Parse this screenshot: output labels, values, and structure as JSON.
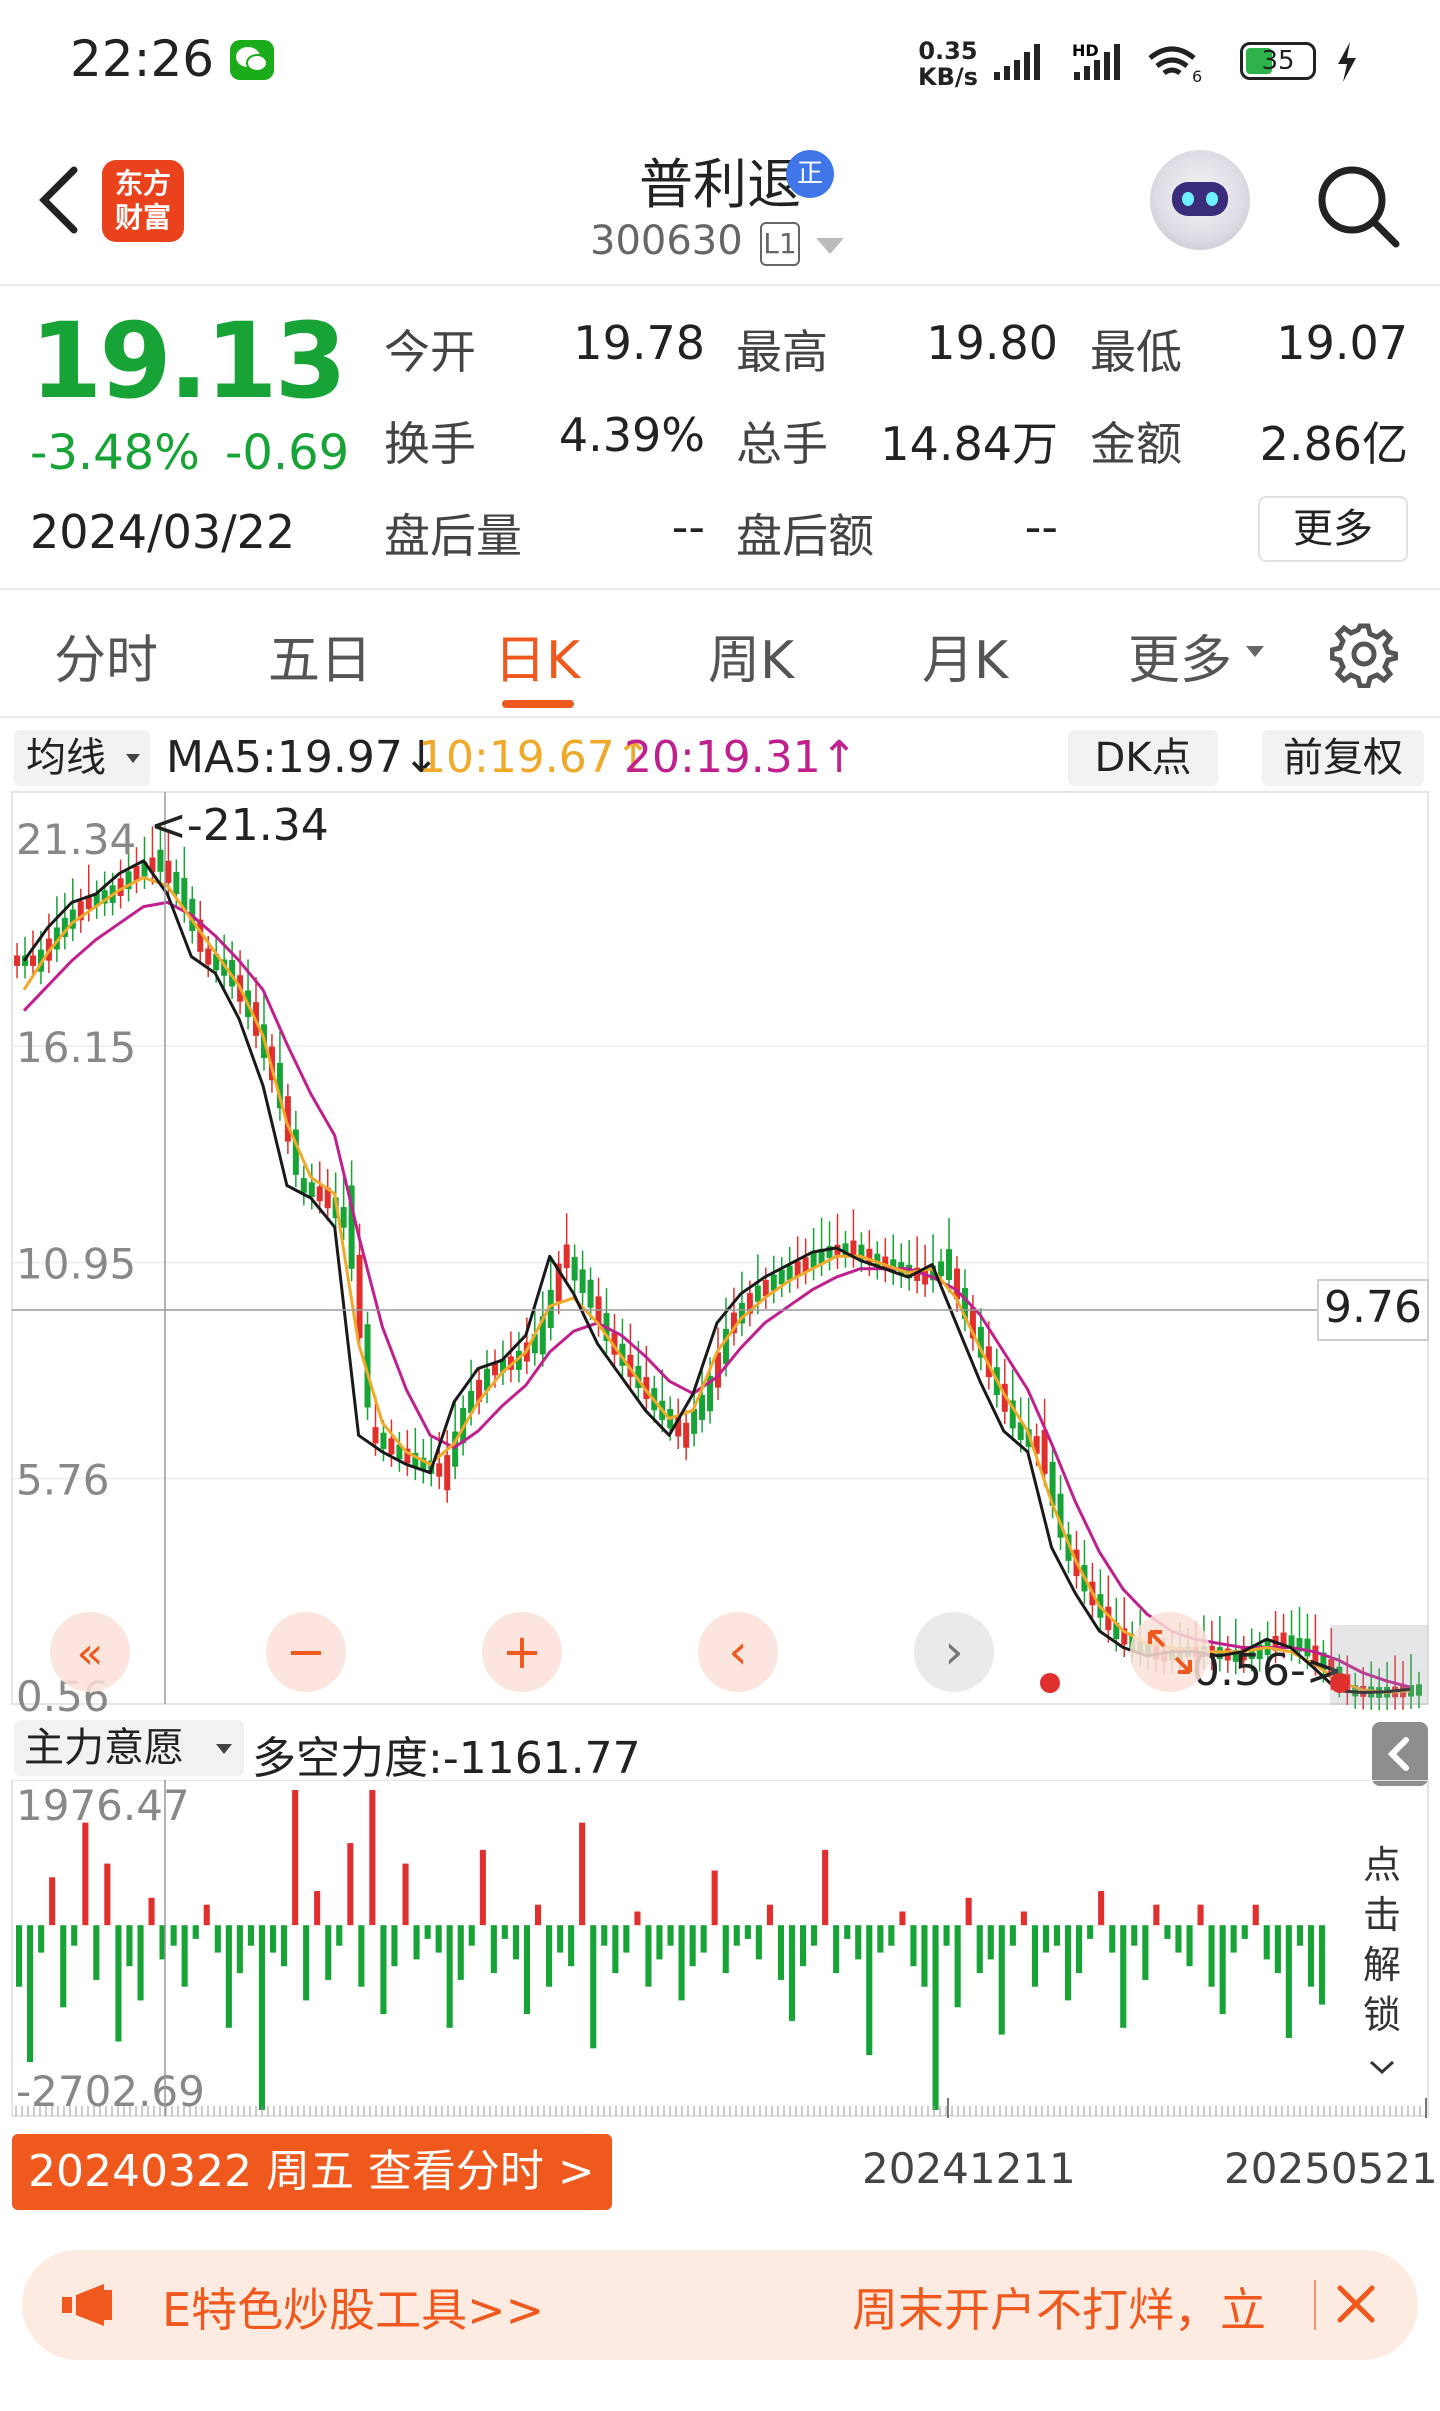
{
  "status_bar": {
    "time": "22:26",
    "net_speed_value": "0.35",
    "net_speed_unit": "KB/s",
    "battery": "35",
    "wifi_label": "6",
    "hd_label": "HD"
  },
  "header": {
    "stock_name": "普利退",
    "badge": "正",
    "stock_code": "300630",
    "level": "L1",
    "app_logo_line1": "东方",
    "app_logo_line2": "财富"
  },
  "quote": {
    "price": "19.13",
    "change_pct": "-3.48%",
    "change_abs": "-0.69",
    "date": "2024/03/22",
    "fields": [
      {
        "label": "今开",
        "value": "19.78",
        "tone": "down"
      },
      {
        "label": "最高",
        "value": "19.80",
        "tone": "down"
      },
      {
        "label": "最低",
        "value": "19.07",
        "tone": "down"
      },
      {
        "label": "换手",
        "value": "4.39%",
        "tone": "neutral"
      },
      {
        "label": "总手",
        "value": "14.84万",
        "tone": "neutral"
      },
      {
        "label": "金额",
        "value": "2.86亿",
        "tone": "neutral"
      },
      {
        "label": "盘后量",
        "value": "--",
        "tone": "neutral"
      },
      {
        "label": "盘后额",
        "value": "--",
        "tone": "neutral"
      }
    ],
    "more_label": "更多"
  },
  "tabs": [
    {
      "label": "分时"
    },
    {
      "label": "五日"
    },
    {
      "label": "日K"
    },
    {
      "label": "周K"
    },
    {
      "label": "月K"
    },
    {
      "label": "更多"
    }
  ],
  "indicator_bar": {
    "ma_select": "均线",
    "ma5": "MA5:19.97↓",
    "ma10": "10:19.67↑",
    "ma20": "20:19.31↑",
    "dk_label": "DK点",
    "fq_label": "前复权"
  },
  "chart_data": [
    {
      "type": "line",
      "title": "",
      "y_tick_labels": [
        "21.34",
        "16.15",
        "10.95",
        "5.76",
        "0.56"
      ],
      "ylim": [
        0.56,
        21.34
      ],
      "annotations": [
        "<-21.34",
        "0.56->",
        "9.76"
      ],
      "crosshair_price": "9.76",
      "series": [
        {
          "name": "MA5",
          "color": "#1a1a1a",
          "values": [
            18.2,
            19.0,
            19.6,
            19.8,
            20.3,
            20.6,
            19.8,
            18.3,
            17.9,
            16.8,
            15.2,
            12.8,
            12.5,
            11.8,
            6.8,
            6.4,
            6.1,
            5.9,
            7.6,
            8.4,
            8.6,
            9.2,
            11.1,
            10.2,
            9.0,
            8.2,
            7.4,
            6.8,
            7.8,
            9.5,
            10.2,
            10.6,
            10.9,
            11.2,
            11.3,
            11.0,
            10.8,
            10.6,
            10.9,
            9.5,
            8.1,
            6.9,
            6.4,
            4.1,
            3.0,
            2.1,
            1.7,
            1.5,
            1.6,
            1.6,
            1.5,
            1.6,
            1.9,
            1.7,
            1.2,
            0.66,
            0.62,
            0.64,
            0.7
          ]
        },
        {
          "name": "MA10",
          "color": "#f0a92a",
          "values": [
            17.5,
            18.4,
            19.1,
            19.5,
            19.9,
            20.2,
            20.0,
            19.2,
            18.4,
            17.6,
            16.4,
            14.3,
            13.0,
            12.6,
            9.0,
            7.1,
            6.4,
            6.1,
            6.6,
            7.6,
            8.3,
            8.8,
            9.9,
            10.1,
            9.5,
            8.7,
            7.9,
            7.2,
            7.4,
            8.8,
            9.6,
            10.1,
            10.5,
            10.8,
            11.1,
            11.1,
            10.9,
            10.7,
            10.8,
            10.1,
            8.9,
            7.8,
            6.9,
            5.2,
            3.8,
            2.7,
            2.1,
            1.8,
            1.7,
            1.6,
            1.6,
            1.6,
            1.7,
            1.6,
            1.3,
            0.9,
            0.68,
            0.62,
            0.66
          ]
        },
        {
          "name": "MA20",
          "color": "#c0208e",
          "values": [
            17.0,
            17.6,
            18.2,
            18.7,
            19.1,
            19.5,
            19.6,
            19.3,
            18.8,
            18.2,
            17.5,
            16.2,
            15.0,
            14.0,
            11.6,
            9.4,
            7.9,
            6.8,
            6.5,
            6.9,
            7.5,
            8.0,
            8.8,
            9.3,
            9.5,
            9.2,
            8.7,
            8.1,
            7.8,
            8.2,
            8.9,
            9.5,
            9.9,
            10.3,
            10.6,
            10.8,
            10.8,
            10.8,
            10.6,
            10.3,
            9.7,
            8.8,
            7.9,
            6.6,
            5.2,
            4.0,
            3.1,
            2.5,
            2.1,
            1.9,
            1.8,
            1.7,
            1.7,
            1.7,
            1.6,
            1.4,
            1.1,
            0.9,
            0.75
          ]
        }
      ]
    },
    {
      "type": "bar",
      "title": "主力意愿",
      "series_name": "多空力度",
      "latest_value": "多空力度:-1161.77",
      "y_tick_labels": [
        "1976.47",
        "-2702.69"
      ],
      "ylim": [
        -2702.69,
        1976.47
      ],
      "x_tick_labels": [
        "20241211",
        "20250521"
      ],
      "values": [
        -900,
        -2000,
        -400,
        700,
        -1200,
        -300,
        1500,
        -800,
        900,
        -1700,
        -600,
        -1100,
        400,
        -500,
        -300,
        -900,
        -200,
        300,
        -400,
        -1500,
        -700,
        -300,
        -2702,
        -400,
        -600,
        1976,
        -1100,
        500,
        -800,
        -300,
        1200,
        -900,
        1976,
        -1300,
        -600,
        900,
        -500,
        -200,
        -400,
        -1500,
        -800,
        -300,
        1100,
        -700,
        -200,
        -500,
        -1300,
        300,
        -900,
        -400,
        -600,
        1500,
        -1800,
        -300,
        -700,
        -400,
        200,
        -900,
        -500,
        -300,
        -1100,
        -600,
        -400,
        800,
        -700,
        -300,
        -200,
        -500,
        300,
        -800,
        -1400,
        -600,
        -300,
        1100,
        -700,
        -200,
        -500,
        -1900,
        -400,
        -300,
        200,
        -600,
        -900,
        -2702,
        -300,
        -1200,
        400,
        -700,
        -500,
        -1600,
        -300,
        200,
        -900,
        -400,
        -300,
        -1100,
        -700,
        -200,
        500,
        -400,
        -1500,
        -300,
        -800,
        300,
        -200,
        -400,
        -600,
        300,
        -900,
        -1300,
        -400,
        -200,
        300,
        -500,
        -700,
        -1650,
        -300,
        -900,
        -1161
      ]
    }
  ],
  "chart_controls": [
    "«",
    "−",
    "+",
    "‹",
    "›"
  ],
  "volume_indicator": {
    "name": "主力意愿",
    "value": "多空力度:-1161.77"
  },
  "unlock_hint": "点击解锁",
  "date_button": "20240322 周五 查看分时 >",
  "promo": {
    "left_text": "E特色炒股工具>>",
    "right_text": "周末开户不打烊，立"
  },
  "colors": {
    "up": "#e0302e",
    "down": "#17a336",
    "accent": "#f0591e"
  }
}
